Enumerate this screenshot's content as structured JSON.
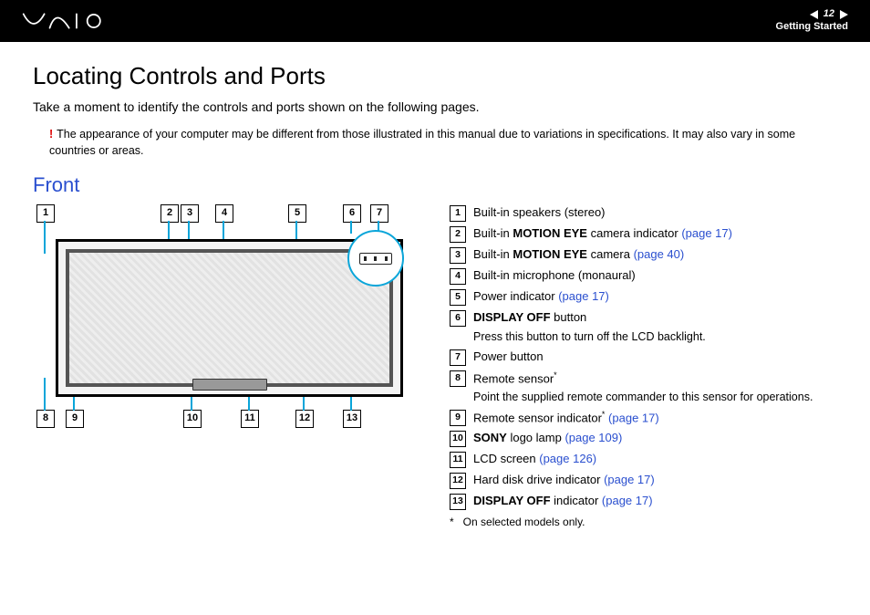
{
  "header": {
    "page_number": "12",
    "section": "Getting Started"
  },
  "title": "Locating Controls and Ports",
  "intro": "Take a moment to identify the controls and ports shown on the following pages.",
  "note_mark": "!",
  "note": "The appearance of your computer may be different from those illustrated in this manual due to variations in specifications. It may also vary in some countries or areas.",
  "subheading": "Front",
  "callouts": {
    "n1": "1",
    "n2": "2",
    "n3": "3",
    "n4": "4",
    "n5": "5",
    "n6": "6",
    "n7": "7",
    "n8": "8",
    "n9": "9",
    "n10": "10",
    "n11": "11",
    "n12": "12",
    "n13": "13"
  },
  "legend": {
    "i1": {
      "n": "1",
      "t": "Built-in speakers (stereo)"
    },
    "i2": {
      "n": "2",
      "pre": "Built-in ",
      "b": "MOTION EYE",
      "post": " camera indicator ",
      "link": "(page 17)"
    },
    "i3": {
      "n": "3",
      "pre": "Built-in ",
      "b": "MOTION EYE",
      "post": " camera ",
      "link": "(page 40)"
    },
    "i4": {
      "n": "4",
      "t": "Built-in microphone (monaural)"
    },
    "i5": {
      "n": "5",
      "t": "Power indicator ",
      "link": "(page 17)"
    },
    "i6": {
      "n": "6",
      "b": "DISPLAY OFF",
      "post": " button",
      "sub": "Press this button to turn off the LCD backlight."
    },
    "i7": {
      "n": "7",
      "t": "Power button"
    },
    "i8": {
      "n": "8",
      "t": "Remote sensor",
      "star": "*",
      "sub": "Point the supplied remote commander to this sensor for operations."
    },
    "i9": {
      "n": "9",
      "t": "Remote sensor indicator",
      "star": "*",
      "post": " ",
      "link": "(page 17)"
    },
    "i10": {
      "n": "10",
      "b": "SONY",
      "post": " logo lamp ",
      "link": "(page 109)"
    },
    "i11": {
      "n": "11",
      "t": "LCD screen ",
      "link": "(page 126)"
    },
    "i12": {
      "n": "12",
      "t": "Hard disk drive indicator ",
      "link": "(page 17)"
    },
    "i13": {
      "n": "13",
      "b": "DISPLAY OFF",
      "post": " indicator ",
      "link": "(page 17)"
    }
  },
  "footnote": {
    "mark": "*",
    "text": "On selected models only."
  }
}
